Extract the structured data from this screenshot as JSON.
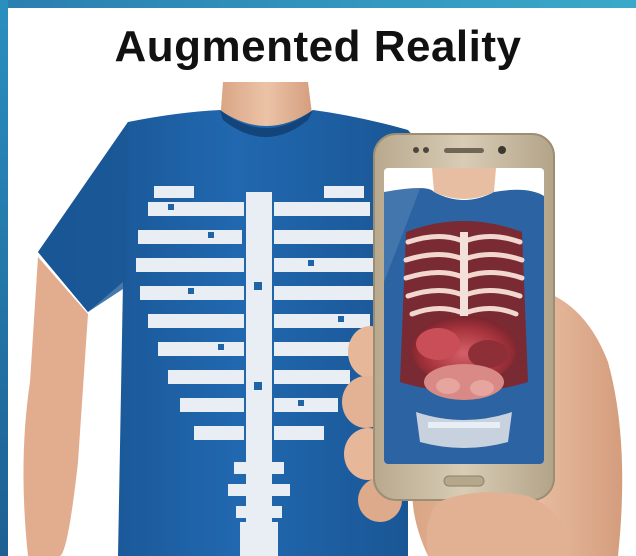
{
  "slide": {
    "title": "Augmented Reality"
  },
  "photo": {
    "subject": "person wearing blue skeleton t-shirt holding smartphone showing AR anatomy view",
    "colors": {
      "shirt": "#1f63a8",
      "shirt_dark": "#164f88",
      "skin": "#e7b79a",
      "phone_body": "#c9bca4",
      "phone_screen_bg": "#2b63a3",
      "organ_red": "#b9404a",
      "rib_pale": "#f1d7d0",
      "accent_top": "#2a7fb0"
    },
    "icons": [
      "skeleton-print",
      "smartphone",
      "ar-anatomy-view"
    ]
  }
}
